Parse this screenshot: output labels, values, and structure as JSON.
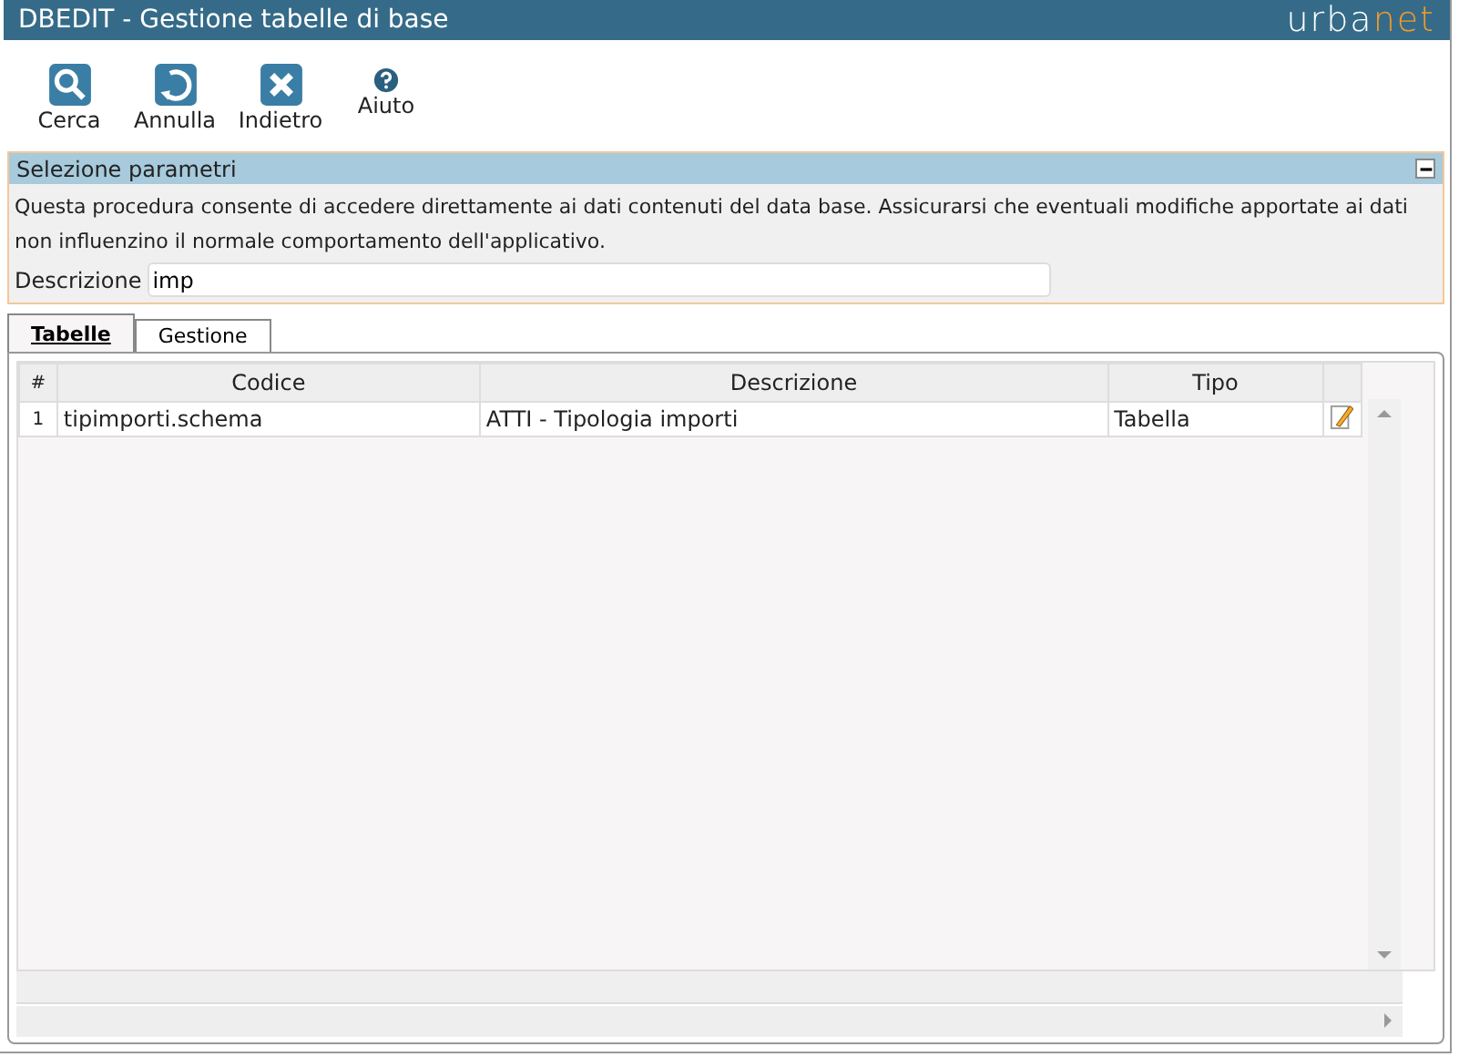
{
  "window": {
    "title": "DBEDIT - Gestione tabelle di base",
    "logo": [
      "urba",
      "net"
    ]
  },
  "toolbar": [
    {
      "label": "Cerca",
      "kind": "search"
    },
    {
      "label": "Annulla",
      "kind": "undo"
    },
    {
      "label": "Indietro",
      "kind": "back"
    },
    {
      "label": "Aiuto",
      "kind": "help"
    }
  ],
  "panel": {
    "title": "Selezione parametri",
    "expanded": true,
    "description": "Questa procedura consente di accedere direttamente ai dati contenuti del data base. Assicurarsi che eventuali modifiche apportate ai dati non influenzino il normale comportamento dell'applicativo.",
    "field": {
      "label": "Descrizione",
      "value": "imp"
    }
  },
  "tabs": [
    {
      "label": "Tabelle",
      "selected": true
    },
    {
      "label": "Gestione",
      "selected": false
    }
  ],
  "table": {
    "columns": [
      "#",
      "Codice",
      "Descrizione",
      "Tipo"
    ],
    "rows": [
      {
        "cells": [
          "1",
          "tipimporti.schema",
          "ATTI - Tipologia importi",
          "Tabella"
        ]
      }
    ]
  }
}
